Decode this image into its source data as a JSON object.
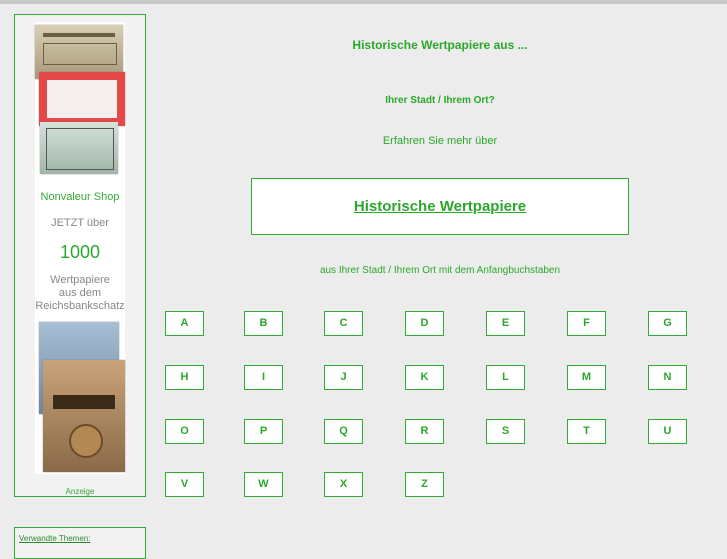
{
  "sidebar": {
    "ad": {
      "shop": "Nonvaleur Shop",
      "jetzt": "JETZT über",
      "count": "1000",
      "desc_lines": [
        "Wertpapiere",
        "aus dem",
        "Reichsbankschatz"
      ],
      "label": "Anzeige"
    },
    "topics_link": "Verwandte Themen:"
  },
  "main": {
    "heading": "Historische Wertpapiere aus ...",
    "subheading": "Ihrer Stadt / Ihrem Ort?",
    "intro": "Erfahren Sie mehr über",
    "main_link": "Historische Wertpapiere",
    "letters_intro": "aus Ihrer Stadt / Ihrem Ort mit dem Anfangbuchstaben",
    "letters": [
      "A",
      "B",
      "C",
      "D",
      "E",
      "F",
      "G",
      "H",
      "I",
      "J",
      "K",
      "L",
      "M",
      "N",
      "O",
      "P",
      "Q",
      "R",
      "S",
      "T",
      "U",
      "V",
      "W",
      "X",
      "Z"
    ]
  },
  "colors": {
    "accent": "#2ba82b",
    "border": "#33aa33",
    "background": "#ececec"
  }
}
